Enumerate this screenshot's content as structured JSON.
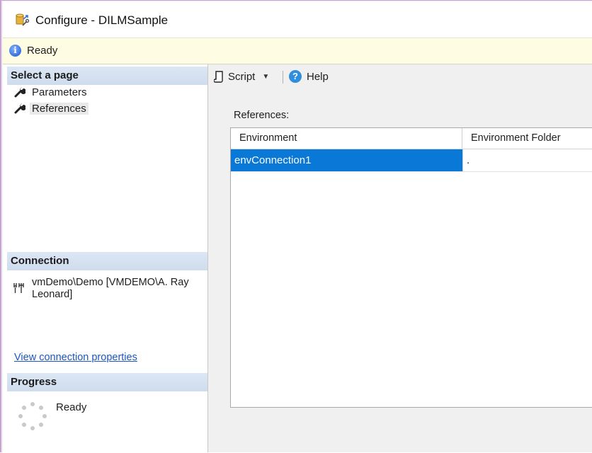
{
  "window": {
    "title": "Configure - DILMSample"
  },
  "status": {
    "text": "Ready"
  },
  "sidebar": {
    "select_page_header": "Select a page",
    "pages": [
      {
        "label": "Parameters",
        "selected": false
      },
      {
        "label": "References",
        "selected": true
      }
    ],
    "connection_header": "Connection",
    "connection_text": "vmDemo\\Demo [VMDEMO\\A. Ray Leonard]",
    "connection_link": "View connection properties",
    "progress_header": "Progress",
    "progress_status": "Ready"
  },
  "toolbar": {
    "script_label": "Script",
    "help_label": "Help"
  },
  "references": {
    "label": "References:",
    "columns": [
      "Environment",
      "Environment Folder"
    ],
    "rows": [
      {
        "environment": "envConnection1",
        "folder": "."
      }
    ]
  },
  "colors": {
    "selection": "#0a78d7",
    "status_bar": "#fefde4",
    "section_header": "#d4e0ef",
    "link": "#1a55c2"
  }
}
